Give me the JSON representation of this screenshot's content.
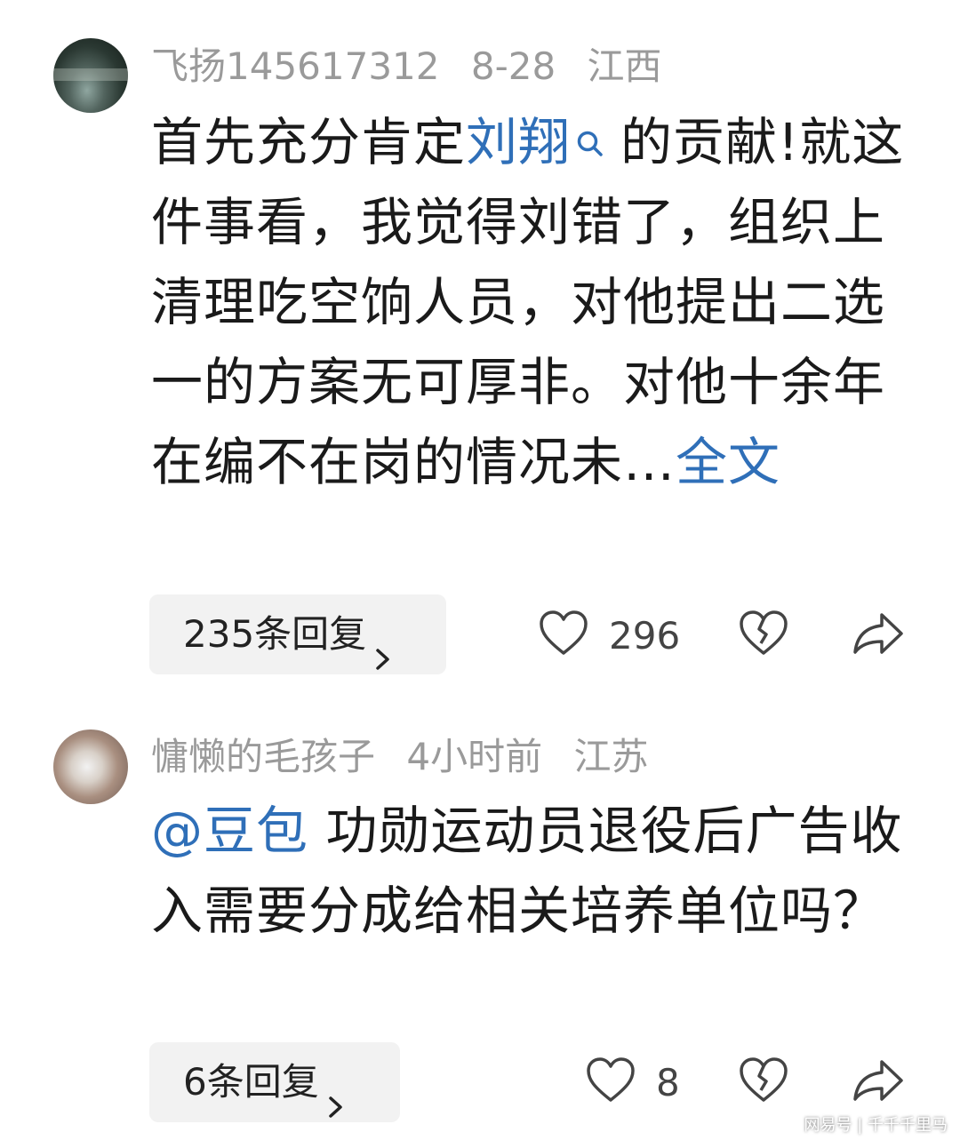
{
  "comments": [
    {
      "username": "飞扬145617312",
      "date": "8-28",
      "location": "江西",
      "text_before_link": "首先充分肯定",
      "link": "刘翔",
      "text_line1_rest": "的贡献!",
      "text_rest": "就这件事看，我觉得刘错了，组织上清理吃空饷人员，对他提出二选一的方案无可厚非。对他十余年在编不在岗的情况未…",
      "full_text_link": "全文",
      "replies_label": "235条回复",
      "likes": "296"
    },
    {
      "username": "慵懒的毛孩子",
      "date": "4小时前",
      "location": "江苏",
      "mention": "@豆包",
      "text": "功勋运动员退役后广告收入需要分成给相关培养单位吗？",
      "replies_label": "6条回复",
      "likes": "8"
    }
  ],
  "watermark": "网易号 | 千千千里马",
  "colors": {
    "link": "#2f6fb8",
    "meta": "#9a9a9a",
    "reply_bg": "#f2f2f2"
  },
  "icons": [
    "search-icon",
    "chevron-right-icon",
    "heart-icon",
    "broken-heart-icon",
    "share-icon"
  ]
}
